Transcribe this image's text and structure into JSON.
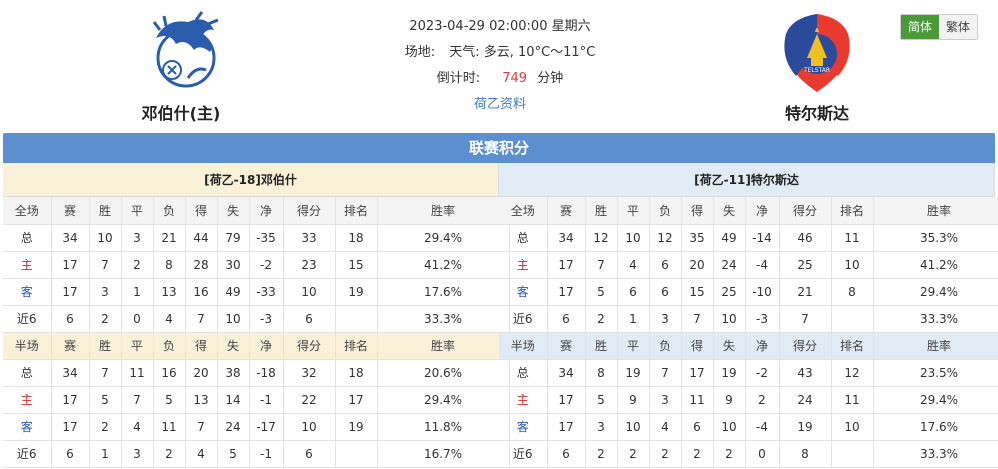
{
  "header": {
    "home_team": "邓伯什(主)",
    "away_team": "特尔斯达",
    "datetime": "2023-04-29 02:00:00 星期六",
    "venue_label": "场地:",
    "weather": "天气: 多云, 10°C～11°C",
    "countdown_label": "倒计时:",
    "countdown_value": "749",
    "countdown_unit": "分钟",
    "league_link": "荷乙资料"
  },
  "lang": {
    "simplified": "简体",
    "traditional": "繁体"
  },
  "banner_title": "联赛积分",
  "columns": [
    "赛",
    "胜",
    "平",
    "负",
    "得",
    "失",
    "净",
    "得分",
    "排名",
    "胜率"
  ],
  "full_label": "全场",
  "half_label": "半场",
  "row_types": [
    "总",
    "主",
    "客",
    "近6"
  ],
  "home": {
    "title": "[荷乙-18]邓伯什",
    "full": [
      [
        "34",
        "10",
        "3",
        "21",
        "44",
        "79",
        "-35",
        "33",
        "18",
        "29.4%"
      ],
      [
        "17",
        "7",
        "2",
        "8",
        "28",
        "30",
        "-2",
        "23",
        "15",
        "41.2%"
      ],
      [
        "17",
        "3",
        "1",
        "13",
        "16",
        "49",
        "-33",
        "10",
        "19",
        "17.6%"
      ],
      [
        "6",
        "2",
        "0",
        "4",
        "7",
        "10",
        "-3",
        "6",
        "",
        "33.3%"
      ]
    ],
    "half": [
      [
        "34",
        "7",
        "11",
        "16",
        "20",
        "38",
        "-18",
        "32",
        "18",
        "20.6%"
      ],
      [
        "17",
        "5",
        "7",
        "5",
        "13",
        "14",
        "-1",
        "22",
        "17",
        "29.4%"
      ],
      [
        "17",
        "2",
        "4",
        "11",
        "7",
        "24",
        "-17",
        "10",
        "19",
        "11.8%"
      ],
      [
        "6",
        "1",
        "3",
        "2",
        "4",
        "5",
        "-1",
        "6",
        "",
        "16.7%"
      ]
    ]
  },
  "away": {
    "title": "[荷乙-11]特尔斯达",
    "full": [
      [
        "34",
        "12",
        "10",
        "12",
        "35",
        "49",
        "-14",
        "46",
        "11",
        "35.3%"
      ],
      [
        "17",
        "7",
        "4",
        "6",
        "20",
        "24",
        "-4",
        "25",
        "10",
        "41.2%"
      ],
      [
        "17",
        "5",
        "6",
        "6",
        "15",
        "25",
        "-10",
        "21",
        "8",
        "29.4%"
      ],
      [
        "6",
        "2",
        "1",
        "3",
        "7",
        "10",
        "-3",
        "7",
        "",
        "33.3%"
      ]
    ],
    "half": [
      [
        "34",
        "8",
        "19",
        "7",
        "17",
        "19",
        "-2",
        "43",
        "12",
        "23.5%"
      ],
      [
        "17",
        "5",
        "9",
        "3",
        "11",
        "9",
        "2",
        "24",
        "11",
        "29.4%"
      ],
      [
        "17",
        "3",
        "10",
        "4",
        "6",
        "10",
        "-4",
        "19",
        "10",
        "17.6%"
      ],
      [
        "6",
        "2",
        "2",
        "2",
        "2",
        "2",
        "0",
        "8",
        "",
        "33.3%"
      ]
    ]
  }
}
